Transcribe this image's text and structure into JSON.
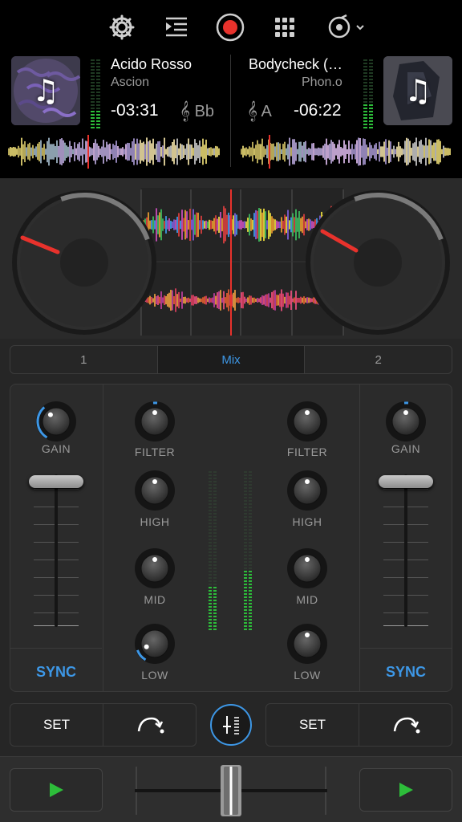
{
  "toolbar": {
    "icons": [
      "settings-gear-icon",
      "playlist-queue-icon",
      "record-icon",
      "grid-apps-icon",
      "vinyl-menu-icon"
    ],
    "accent_record": "#e8322c"
  },
  "deck1": {
    "title": "Acido Rosso",
    "artist": "Ascion",
    "time": "-03:31",
    "key": "Bb",
    "art_icon": "music-note-icon"
  },
  "deck2": {
    "title": "Bodycheck (…",
    "artist": "Phon.o",
    "time": "-06:22",
    "key": "A",
    "art_icon": "music-note-icon"
  },
  "tabs": [
    {
      "label": "1",
      "active": false
    },
    {
      "label": "Mix",
      "active": true
    },
    {
      "label": "2",
      "active": false
    }
  ],
  "mixer": {
    "left_gain_label": "GAIN",
    "right_gain_label": "GAIN",
    "left_filter_label": "FILTER",
    "right_filter_label": "FILTER",
    "left_high_label": "HIGH",
    "right_high_label": "HIGH",
    "left_mid_label": "MID",
    "right_mid_label": "MID",
    "left_low_label": "LOW",
    "right_low_label": "LOW",
    "left_sync_label": "SYNC",
    "right_sync_label": "SYNC",
    "left_volume_level": 0.95,
    "right_volume_level": 0.95,
    "left_meter_level": 0.28,
    "right_meter_level": 0.38
  },
  "cue_bar": {
    "left_set_label": "SET",
    "right_set_label": "SET",
    "loop_icon": "arrow-curve-icon",
    "center_icon": "mixer-eq-icon"
  },
  "transport": {
    "left_play_icon": "play-icon",
    "right_play_icon": "play-icon",
    "crossfader_position": 0.5
  },
  "colors": {
    "accent": "#3d97e6",
    "play": "#2dbd3a",
    "playhead": "#e8322c"
  }
}
